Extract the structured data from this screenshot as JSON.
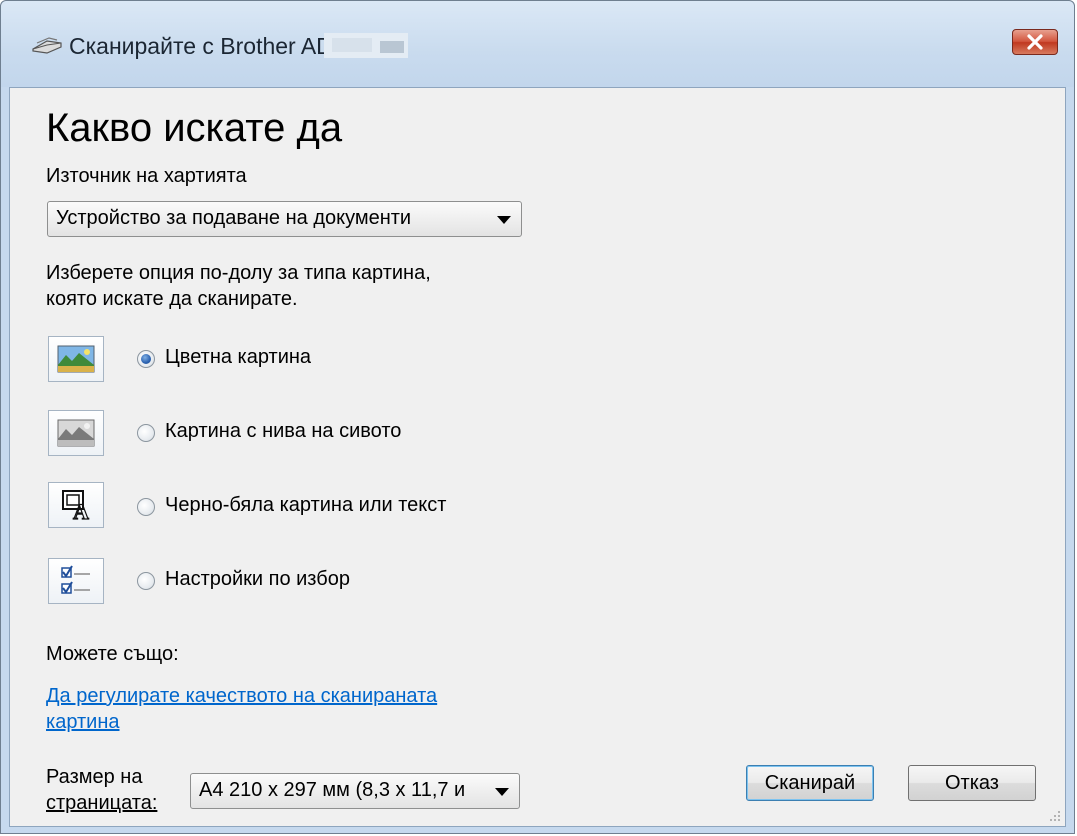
{
  "window": {
    "title": "Сканирайте с Brother ADS-",
    "close_label": "×"
  },
  "main": {
    "heading": "Какво искате да",
    "paper_source_label": "Източник на хартията",
    "paper_source_value": "Устройство за подаване на документи",
    "instruction_line1": "Изберете опция по-долу за типа картина,",
    "instruction_line2": "която искате да сканирате.",
    "options": [
      {
        "label": "Цветна картина",
        "checked": true,
        "icon": "color-picture-icon"
      },
      {
        "label": "Картина с нива на сивото",
        "checked": false,
        "icon": "grayscale-picture-icon"
      },
      {
        "label": "Черно-бяла картина или текст",
        "checked": false,
        "icon": "black-white-text-icon"
      },
      {
        "label": "Настройки по избор",
        "checked": false,
        "icon": "custom-settings-icon"
      }
    ],
    "also_label": "Можете също:",
    "adjust_link_line1": "Да регулирате качеството на сканираната",
    "adjust_link_line2": "картина"
  },
  "footer": {
    "page_size_label_line1": "Размер на",
    "page_size_label_line2": "страницата:",
    "page_size_value": "A4 210 x 297 мм (8,3 x 11,7 и",
    "scan_button": "Сканирай",
    "cancel_button": "Отказ"
  },
  "colors": {
    "link": "#0066cc",
    "titlebar": "#c9dbee",
    "client_bg": "#f0f0f0",
    "close_button": "#c7442a"
  }
}
